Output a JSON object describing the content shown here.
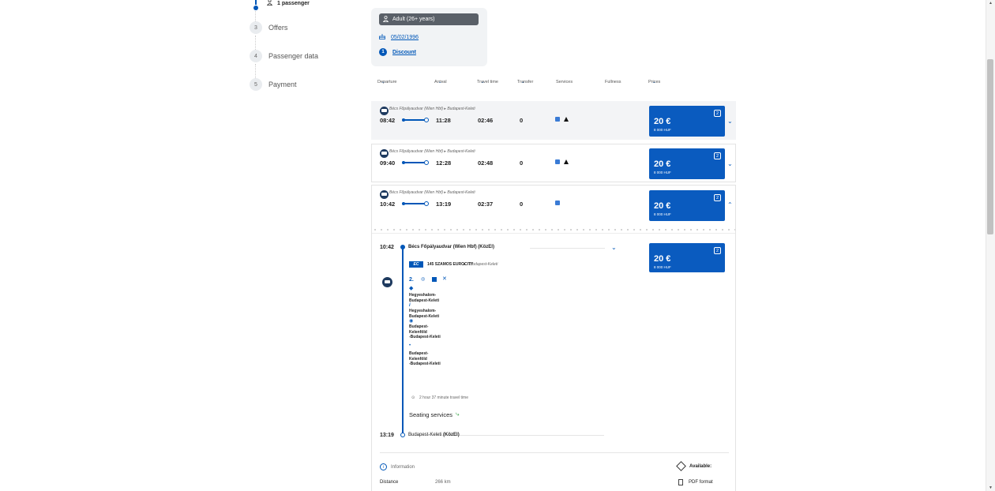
{
  "stepper": {
    "passenger_label": "1 passenger",
    "steps": [
      {
        "num": "3",
        "label": "Offers"
      },
      {
        "num": "4",
        "label": "Passenger data"
      },
      {
        "num": "5",
        "label": "Payment"
      }
    ]
  },
  "passenger_box": {
    "adult_label": "Adult (26+ years)",
    "birth_date": "05/02/1996",
    "discount_count": "1",
    "discount_label": "Discount"
  },
  "columns": {
    "departure": "Departure",
    "arrival": "Arrival",
    "travel_time": "Travel time",
    "transfer": "Transfer",
    "services": "Services",
    "fullness": "Fullness",
    "prices": "Prices"
  },
  "offers": [
    {
      "route": "Bécs Főpályaudvar (Wien Hbf)  ▸  Budapest-Keleti",
      "dep": "08:42",
      "arr": "11:28",
      "dur": "02:46",
      "transfer": "0",
      "price": "20 €",
      "price_huf": "8 000 HUF",
      "count": "2",
      "chev": "⌄"
    },
    {
      "route": "Bécs Főpályaudvar (Wien Hbf)  ▸  Budapest-Keleti",
      "dep": "09:40",
      "arr": "12:28",
      "dur": "02:48",
      "transfer": "0",
      "price": "20 €",
      "price_huf": "8 000 HUF",
      "count": "2",
      "chev": "⌄"
    },
    {
      "route": "Bécs Főpályaudvar (Wien Hbf)  ▸  Budapest-Keleti",
      "dep": "10:42",
      "arr": "13:19",
      "dur": "02:37",
      "transfer": "0",
      "price": "20 €",
      "price_huf": "8 000 HUF",
      "count": "2",
      "chev": "⌃"
    }
  ],
  "detail": {
    "dep_time": "10:42",
    "dep_station": "Bécs Főpályaudvar (Wien Hbf) (KözEl)",
    "train_badge": "EC",
    "train_name": "145 SZAMOS EUROCITY",
    "train_dest": "Budapest-Keleti",
    "class_label": "2.",
    "segments": [
      "Hegyeshalom-\nBudapest-Keleti",
      "Hegyeshalom-\nBudapest-Keleti",
      "Budapest-\nKelenföld\n-Budapest-Keleti",
      "Budapest-\nKelenföld\n-Budapest-Keleti"
    ],
    "travel_time": "2 hour 37 minute travel time",
    "seating": "Seating services",
    "arr_time": "13:19",
    "arr_station": "Budapest-Keleti",
    "arr_station_suffix": "(KözEl)",
    "price": "20 €",
    "price_huf": "8 000 HUF",
    "count": "2",
    "info_label": "Information",
    "distance_label": "Distance",
    "distance_value": "266 km",
    "available_label": "Available:",
    "pdf_label": "PDF format"
  },
  "colors": {
    "accent": "#0057b8",
    "price_bg": "#0a5bbf"
  }
}
